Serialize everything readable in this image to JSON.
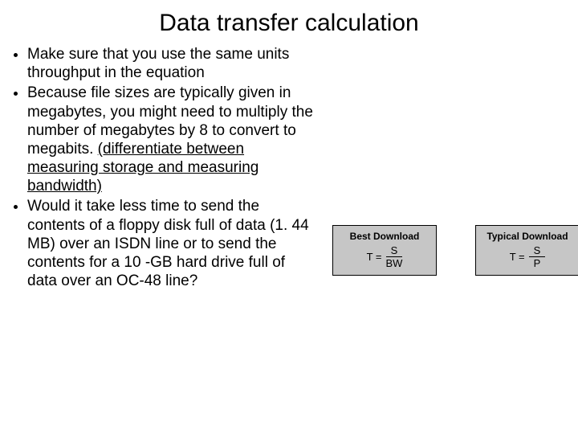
{
  "title": "Data transfer calculation",
  "bullets": {
    "b1": "Make sure that you use the same units throughput in the equation",
    "b2a": "Because file sizes are typically given in megabytes, you might need to multiply the number of megabytes by 8 to convert to megabits. ",
    "b2b": "(differentiate between measuring storage and measuring bandwidth)",
    "b3": "Would it take less time to send the contents of a floppy disk full of data (1. 44 MB) over an ISDN line or to send the contents for a 10 -GB hard drive full of data over an OC-48 line?"
  },
  "formula": {
    "best": {
      "label": "Best Download",
      "lhs": "T =",
      "num": "S",
      "den": "BW"
    },
    "typical": {
      "label": "Typical Download",
      "lhs": "T =",
      "num": "S",
      "den": "P"
    }
  }
}
